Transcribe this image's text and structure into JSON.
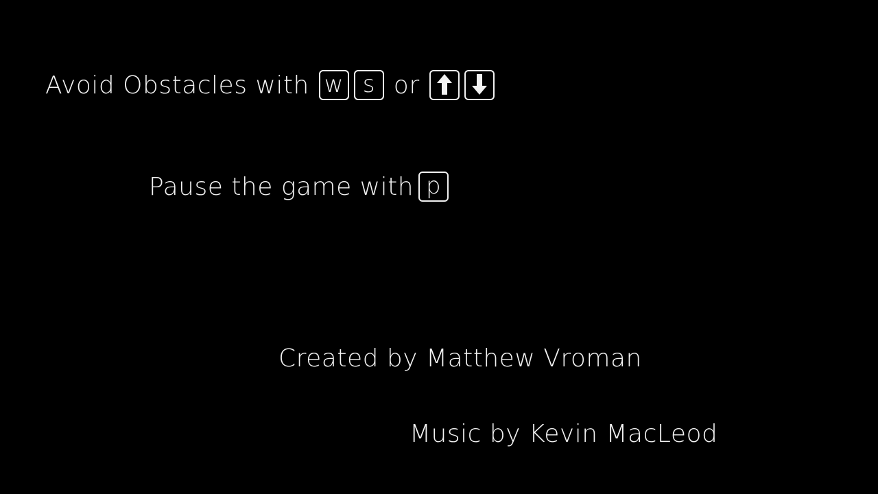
{
  "colors": {
    "background": "#000000",
    "text": "#f2f2f2"
  },
  "instructions": {
    "avoid": {
      "text": "Avoid Obstacles with",
      "key_w": "w",
      "key_s": "s",
      "or_text": "or",
      "key_up_icon": "arrow-up-icon",
      "key_down_icon": "arrow-down-icon"
    },
    "pause": {
      "text": "Pause the game with",
      "key_p": "p"
    }
  },
  "credits": {
    "created_by": "Created by Matthew Vroman",
    "music_by": "Music by Kevin MacLeod"
  }
}
